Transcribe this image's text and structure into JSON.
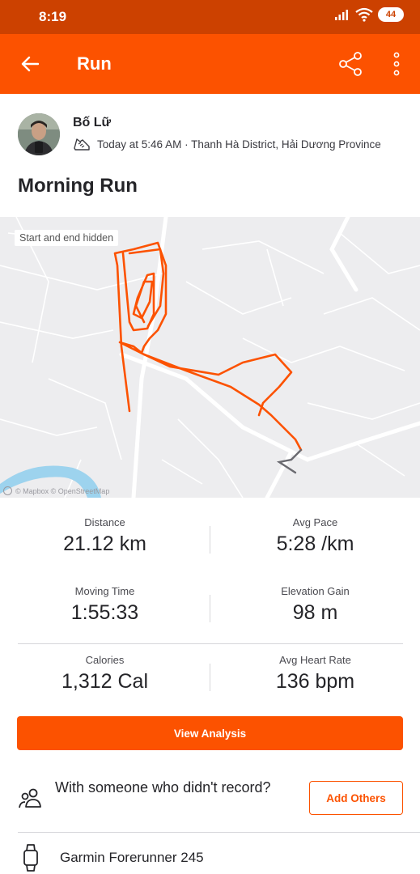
{
  "status_bar": {
    "time": "8:19",
    "battery": "44",
    "icons": [
      "signal-icon",
      "wifi-icon",
      "battery-icon"
    ]
  },
  "toolbar": {
    "title": "Run",
    "back_icon": "arrow-left-icon",
    "share_icon": "share-icon",
    "more_icon": "more-vertical-icon"
  },
  "athlete": {
    "name": "Bố Lữ",
    "activity_meta": "Today at 5:46 AM · Thanh Hà District, Hải Dương Province",
    "shoe_icon": "running-shoe-icon"
  },
  "activity": {
    "title": "Morning Run"
  },
  "map": {
    "badge": "Start and end hidden",
    "attribution": "© Mapbox © OpenStreetMap",
    "route_color": "#fc5200"
  },
  "stats": [
    {
      "label": "Distance",
      "value": "21.12 km"
    },
    {
      "label": "Avg Pace",
      "value": "5:28 /km"
    },
    {
      "label": "Moving Time",
      "value": "1:55:33"
    },
    {
      "label": "Elevation Gain",
      "value": "98 m"
    },
    {
      "label": "Calories",
      "value": "1,312 Cal"
    },
    {
      "label": "Avg Heart Rate",
      "value": "136 bpm"
    }
  ],
  "actions": {
    "view_analysis": "View Analysis",
    "others_prompt": "With someone who didn't record?",
    "add_others": "Add Others"
  },
  "device": {
    "name": "Garmin Forerunner 245",
    "icon": "watch-icon"
  },
  "colors": {
    "brand": "#fc5200",
    "status_bar": "#cc4100"
  }
}
